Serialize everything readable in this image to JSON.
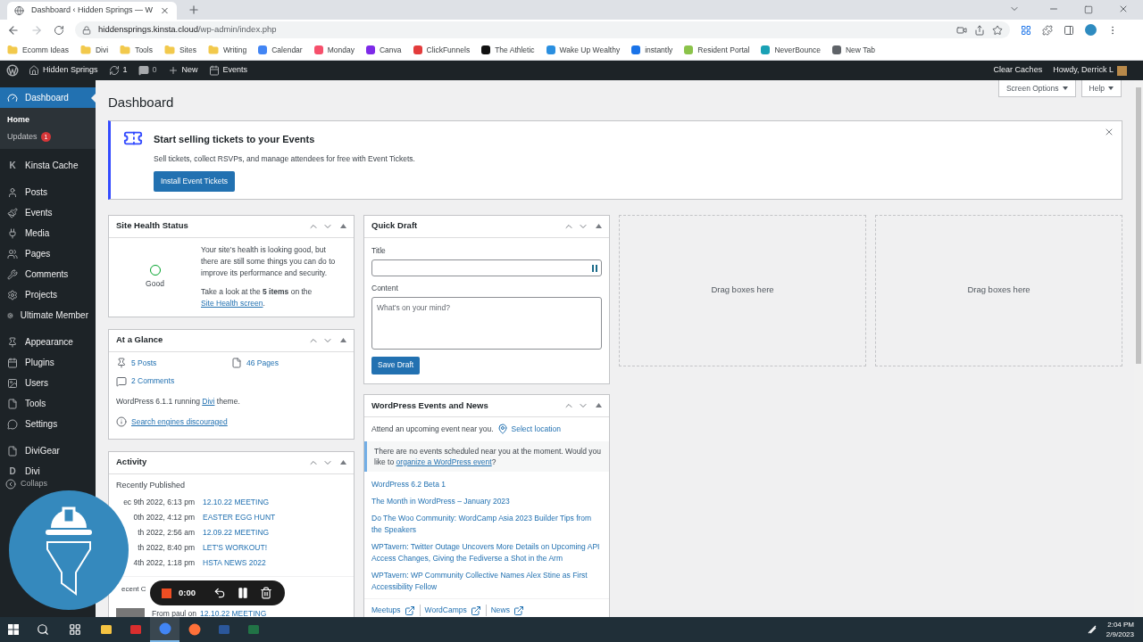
{
  "browser": {
    "tab_title": "Dashboard ‹ Hidden Springs — W",
    "url_host": "hiddensprings.kinsta.cloud",
    "url_path": "/wp-admin/index.php",
    "bookmarks": [
      {
        "label": "Ecomm Ideas",
        "kind": "folder"
      },
      {
        "label": "Divi",
        "kind": "folder"
      },
      {
        "label": "Tools",
        "kind": "folder"
      },
      {
        "label": "Sites",
        "kind": "folder"
      },
      {
        "label": "Writing",
        "kind": "folder"
      },
      {
        "label": "Calendar",
        "kind": "site",
        "color": "#4285f4"
      },
      {
        "label": "Monday",
        "kind": "site",
        "color": "#f64f6b"
      },
      {
        "label": "Canva",
        "kind": "site",
        "color": "#7d2ae8"
      },
      {
        "label": "ClickFunnels",
        "kind": "site",
        "color": "#e33b3b"
      },
      {
        "label": "The Athletic",
        "kind": "site",
        "color": "#111111"
      },
      {
        "label": "Wake Up Wealthy",
        "kind": "site",
        "color": "#2a8fe0"
      },
      {
        "label": "instantly",
        "kind": "site",
        "color": "#1a73e8"
      },
      {
        "label": "Resident Portal",
        "kind": "site",
        "color": "#8bc34a"
      },
      {
        "label": "NeverBounce",
        "kind": "site",
        "color": "#1aa1b5"
      },
      {
        "label": "New Tab",
        "kind": "site",
        "color": "#5f6368"
      }
    ]
  },
  "admin_bar": {
    "site_name": "Hidden Springs",
    "updates": "1",
    "comments": "0",
    "new": "New",
    "events": "Events",
    "clear_caches": "Clear Caches",
    "howdy": "Howdy, Derrick L"
  },
  "sidebar": {
    "groups": [
      {
        "items": [
          {
            "label": "Dashboard",
            "selected": true,
            "children": [
              {
                "label": "Home",
                "selected": true
              },
              {
                "label": "Updates",
                "selected": false,
                "badge": "1"
              }
            ]
          }
        ]
      },
      {
        "items": [
          {
            "label": "Kinsta Cache",
            "selected": false,
            "icon_text": "K"
          }
        ]
      },
      {
        "items": [
          {
            "label": "Posts",
            "selected": false
          },
          {
            "label": "Events",
            "selected": false
          },
          {
            "label": "Media",
            "selected": false
          },
          {
            "label": "Pages",
            "selected": false
          },
          {
            "label": "Comments",
            "selected": false
          },
          {
            "label": "Projects",
            "selected": false
          },
          {
            "label": "Ultimate Member",
            "selected": false
          }
        ]
      },
      {
        "items": [
          {
            "label": "Appearance",
            "selected": false
          },
          {
            "label": "Plugins",
            "selected": false
          },
          {
            "label": "Users",
            "selected": false
          },
          {
            "label": "Tools",
            "selected": false
          },
          {
            "label": "Settings",
            "selected": false
          }
        ]
      },
      {
        "items": [
          {
            "label": "DiviGear",
            "selected": false
          },
          {
            "label": "Divi",
            "selected": false,
            "icon_text": "D"
          }
        ]
      }
    ],
    "collapse": "Collaps"
  },
  "page": {
    "title": "Dashboard",
    "screen_options": "Screen Options",
    "help": "Help"
  },
  "notice": {
    "title": "Start selling tickets to your Events",
    "text": "Sell tickets, collect RSVPs, and manage attendees for free with Event Tickets.",
    "button": "Install Event Tickets"
  },
  "site_health": {
    "title": "Site Health Status",
    "status": "Good",
    "text": "Your site's health is looking good, but there are still some things you can do to improve its performance and security.",
    "look": "Take a look at the **5 items** on the",
    "link": "Site Health screen",
    "end": "."
  },
  "at_a_glance": {
    "title": "At a Glance",
    "stats": [
      {
        "label": "5 Posts"
      },
      {
        "label": "46 Pages"
      },
      {
        "label": "2 Comments"
      }
    ],
    "version": "WordPress 6.1.1 running",
    "theme": "Divi",
    "version_end": "theme.",
    "search_engines": "Search engines discouraged"
  },
  "activity": {
    "title": "Activity",
    "heading": "Recently Published",
    "posts": [
      {
        "date": "ec 9th 2022, 6:13 pm",
        "title": "12.10.22 MEETING"
      },
      {
        "date": "0th 2022, 4:12 pm",
        "title": "EASTER EGG HUNT"
      },
      {
        "date": "th 2022, 2:56 am",
        "title": "12.09.22 MEETING"
      },
      {
        "date": "th 2022, 8:40 pm",
        "title": "LET'S WORKOUT!"
      },
      {
        "date": "4th 2022, 1:18 pm",
        "title": "HSTA NEWS 2022"
      }
    ],
    "comments_heading": "ecent C",
    "comment_from": "From paul on",
    "comment_link": "12.10.22 MEETING"
  },
  "quick_draft": {
    "title": "Quick Draft",
    "title_label": "Title",
    "content_label": "Content",
    "placeholder": "What's on your mind?",
    "button": "Save Draft"
  },
  "events_news": {
    "title": "WordPress Events and News",
    "attend": "Attend an upcoming event near you.",
    "select_location": "Select location",
    "notice": "There are no events scheduled near you at the moment. Would you like to",
    "notice_link": "organize a WordPress event",
    "notice_end": "?",
    "news": [
      {
        "label": "WordPress 6.2 Beta 1"
      },
      {
        "label": "The Month in WordPress – January 2023"
      },
      {
        "label": "Do The Woo Community: WordCamp Asia 2023 Builder Tips from the Speakers"
      },
      {
        "label": "WPTavern: Twitter Outage Uncovers More Details on Upcoming API Access Changes, Giving the Fediverse a Shot in the Arm"
      },
      {
        "label": "WPTavern: WP Community Collective Names Alex Stine as First Accessibility Fellow"
      }
    ],
    "footer": [
      {
        "label": "Meetups"
      },
      {
        "label": "WordCamps"
      },
      {
        "label": "News"
      }
    ]
  },
  "drop_zones": [
    {
      "label": "Drag boxes here"
    },
    {
      "label": "Drag boxes here"
    }
  ],
  "recorder": {
    "time": "0:00"
  },
  "taskbar": {
    "time": "2:04 PM",
    "date": "2/9/2023",
    "apps": [
      {
        "selected": false
      },
      {
        "selected": false
      },
      {
        "selected": true
      },
      {
        "selected": false
      },
      {
        "selected": false
      },
      {
        "selected": false
      }
    ]
  }
}
